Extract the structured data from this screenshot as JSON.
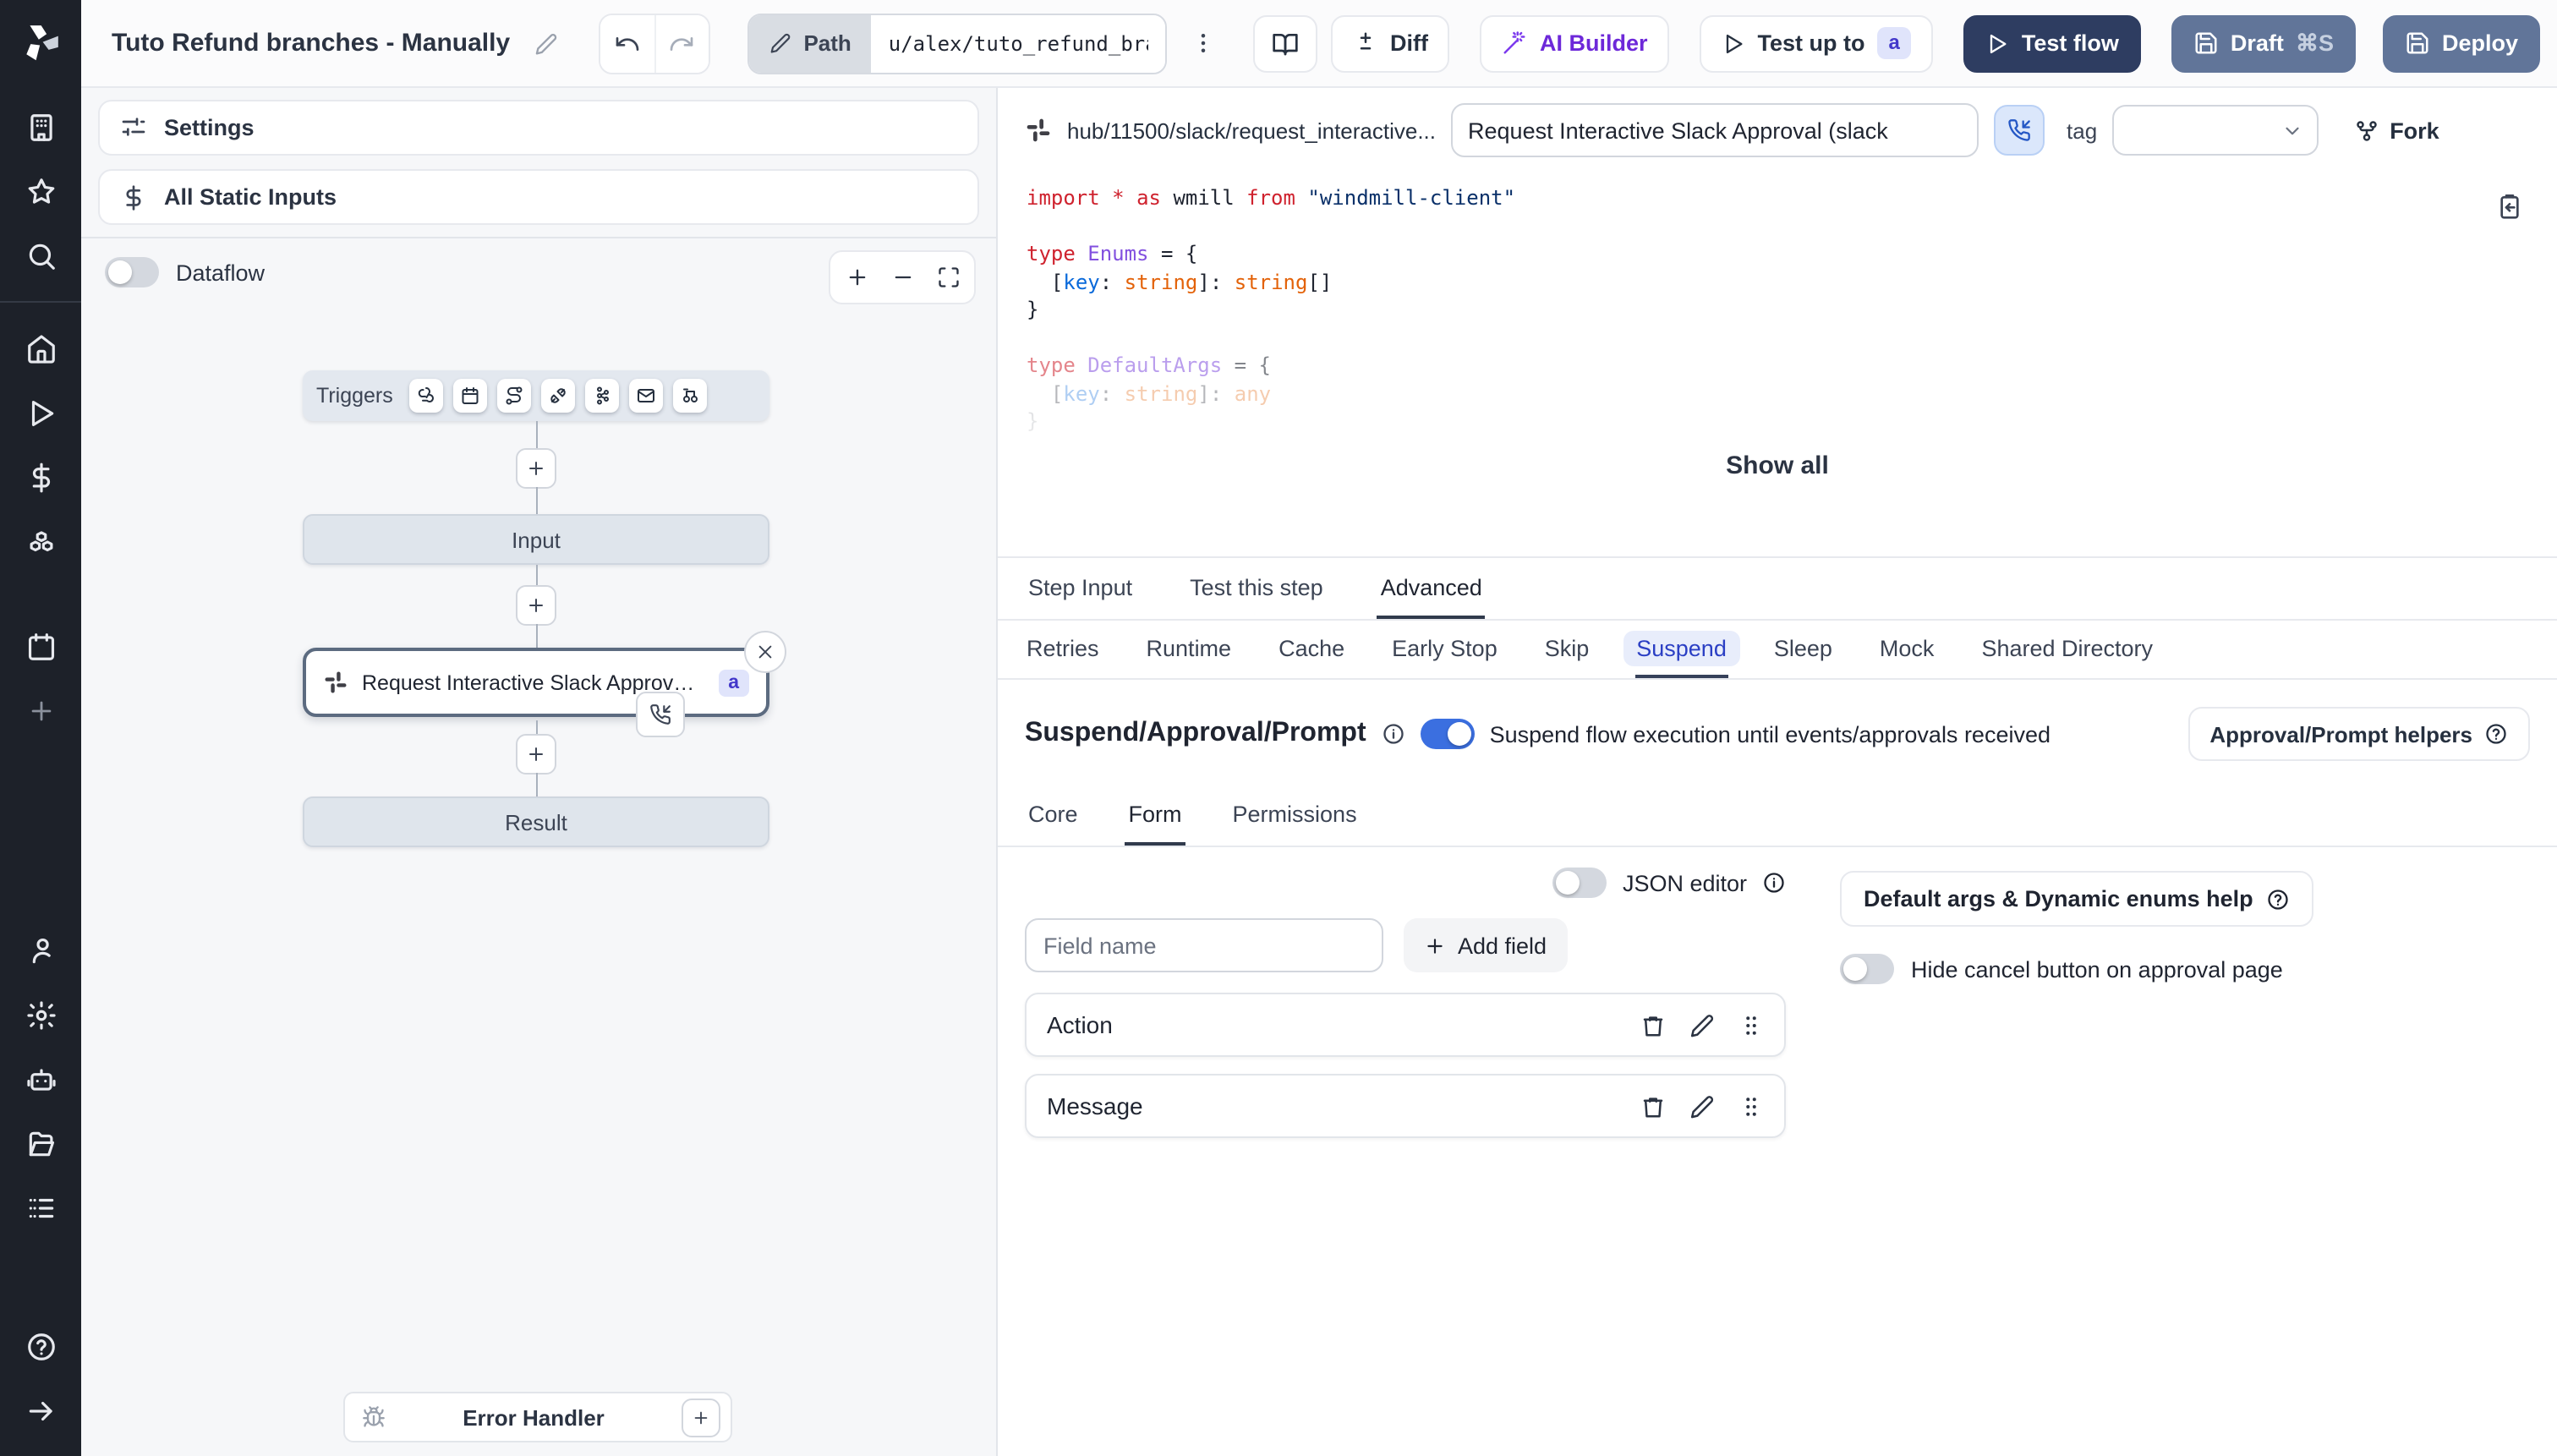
{
  "topbar": {
    "title": "Tuto Refund branches - Manually",
    "path_label": "Path",
    "path_value": "u/alex/tuto_refund_branches__",
    "diff_label": "Diff",
    "ai_builder_label": "AI Builder",
    "test_up_to_label": "Test up to",
    "test_up_to_badge": "a",
    "test_flow_label": "Test flow",
    "draft_label": "Draft",
    "draft_shortcut": "⌘S",
    "deploy_label": "Deploy"
  },
  "sidebar": {
    "icon_names": [
      "windmill-logo",
      "workspace",
      "favorites",
      "search",
      "home",
      "runs",
      "variables",
      "resources",
      "schedules",
      "add",
      "user",
      "settings",
      "ai-bot",
      "folders",
      "apps",
      "help",
      "expand-sidebar"
    ]
  },
  "flow_panel": {
    "settings_label": "Settings",
    "all_static_inputs_label": "All Static Inputs",
    "dataflow_label": "Dataflow",
    "triggers_label": "Triggers",
    "trigger_icon_names": [
      "webhook",
      "schedule",
      "http-route",
      "websocket",
      "kafka",
      "email",
      "poll"
    ],
    "input_node_label": "Input",
    "step_node_label": "Request Interactive Slack Approval (...",
    "step_node_badge": "a",
    "result_node_label": "Result",
    "error_handler_label": "Error Handler"
  },
  "editor": {
    "hub_path": "hub/11500/slack/request_interactive...",
    "summary_value": "Request Interactive Slack Approval (slack",
    "tag_label": "tag",
    "fork_label": "Fork",
    "show_all_label": "Show all",
    "code_lines": [
      {
        "f": 0,
        "t": [
          [
            "k",
            "import "
          ],
          [
            "k",
            "* "
          ],
          [
            "k",
            "as "
          ],
          [
            "n",
            "wmill "
          ],
          [
            "k",
            "from "
          ],
          [
            "s",
            "\"windmill-client\""
          ]
        ]
      },
      {
        "f": 0,
        "t": []
      },
      {
        "f": 0,
        "t": [
          [
            "k",
            "type "
          ],
          [
            "t",
            "Enums "
          ],
          [
            "n",
            "= {"
          ]
        ]
      },
      {
        "f": 0,
        "t": [
          [
            "n",
            "  ["
          ],
          [
            "p",
            "key"
          ],
          [
            "n",
            ": "
          ],
          [
            "b",
            "string"
          ],
          [
            "n",
            "]: "
          ],
          [
            "b",
            "string"
          ],
          [
            "n",
            "[]"
          ]
        ]
      },
      {
        "f": 0,
        "t": [
          [
            "n",
            "}"
          ]
        ]
      },
      {
        "f": 0,
        "t": []
      },
      {
        "f": 1,
        "t": [
          [
            "k",
            "type "
          ],
          [
            "t",
            "DefaultArgs "
          ],
          [
            "n",
            "= {"
          ]
        ]
      },
      {
        "f": 2,
        "t": [
          [
            "n",
            "  ["
          ],
          [
            "p",
            "key"
          ],
          [
            "n",
            ": "
          ],
          [
            "b",
            "string"
          ],
          [
            "n",
            "]: "
          ],
          [
            "b",
            "any"
          ]
        ]
      },
      {
        "f": 3,
        "t": [
          [
            "n",
            "}"
          ]
        ]
      }
    ]
  },
  "step_tabs": {
    "items": [
      "Step Input",
      "Test this step",
      "Advanced"
    ],
    "active": "Advanced"
  },
  "advanced_tabs": {
    "items": [
      "Retries",
      "Runtime",
      "Cache",
      "Early Stop",
      "Skip",
      "Suspend",
      "Sleep",
      "Mock",
      "Shared Directory"
    ],
    "active": "Suspend"
  },
  "suspend_section": {
    "title": "Suspend/Approval/Prompt",
    "toggle_on": true,
    "toggle_description": "Suspend flow execution until events/approvals received",
    "helpers_button_label": "Approval/Prompt helpers",
    "tabs": [
      "Core",
      "Form",
      "Permissions"
    ],
    "active_tab": "Form",
    "json_editor_label": "JSON editor",
    "json_editor_on": false,
    "field_name_placeholder": "Field name",
    "add_field_label": "Add field",
    "fields": [
      "Action",
      "Message"
    ],
    "default_args_help_label": "Default args & Dynamic enums help",
    "hide_cancel_label": "Hide cancel button on approval page",
    "hide_cancel_on": false
  },
  "colors": {
    "rail_bg": "#1d2129",
    "accent_blue": "#3b6fe0",
    "test_flow_navy": "#2e3d61",
    "draft_deploy_slate": "#617599",
    "badge_indigo_bg": "#e0e4fb",
    "badge_indigo_text": "#4338ca",
    "suspend_tab_blue": "#2b3fc4",
    "ai_builder_purple": "#6d28d9"
  }
}
